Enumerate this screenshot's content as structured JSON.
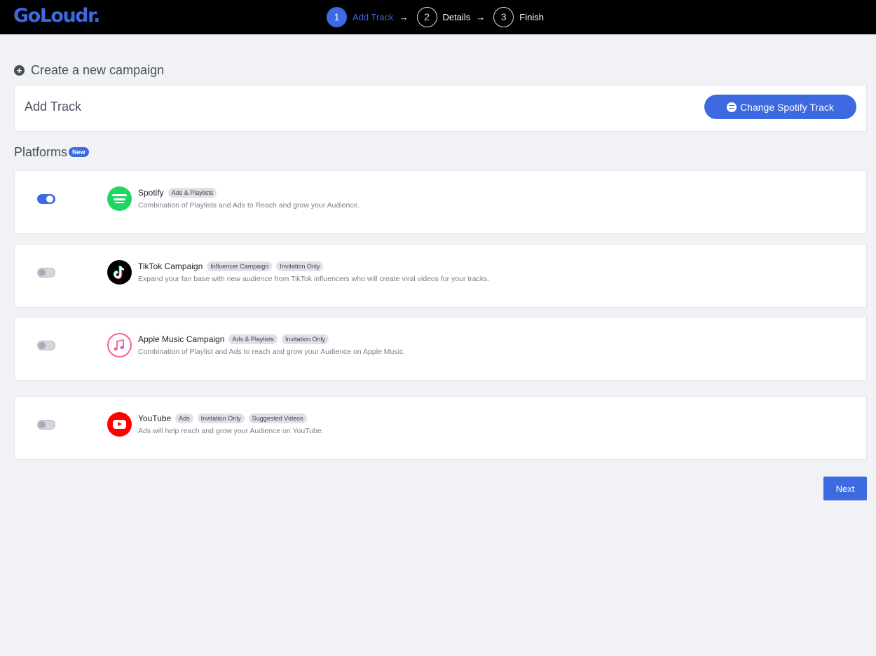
{
  "brand": {
    "logo": "GoLoudr."
  },
  "steps": [
    {
      "number": "1",
      "label": "Add Track",
      "active": true
    },
    {
      "number": "2",
      "label": "Details",
      "active": false
    },
    {
      "number": "3",
      "label": "Finish",
      "active": false
    }
  ],
  "page": {
    "title": "Create a new campaign"
  },
  "track": {
    "title": "Add Track",
    "change_button": "Change Spotify Track"
  },
  "platforms_section": {
    "title": "Platforms",
    "badge": "New"
  },
  "platforms": [
    {
      "name": "Spotify",
      "tags": [
        "Ads & Playlists"
      ],
      "description": "Combination of Playlists and Ads to Reach and grow your Audience.",
      "enabled": true,
      "icon": "spotify-icon"
    },
    {
      "name": "TikTok Campaign",
      "tags": [
        "Influencer Campaign",
        "Invitation Only"
      ],
      "description": "Expand your fan base with new audience from TikTok influencers who will create viral videos for your tracks.",
      "enabled": false,
      "icon": "tiktok-icon"
    },
    {
      "name": "Apple Music Campaign",
      "tags": [
        "Ads & Playlists",
        "Invitation Only"
      ],
      "description": "Combination of Playlist and Ads to reach and grow your Audience on Apple Music.",
      "enabled": false,
      "icon": "apple-music-icon"
    },
    {
      "name": "YouTube",
      "tags": [
        "Ads",
        "Invitation Only",
        "Suggested Videos"
      ],
      "description": "Ads will help reach and grow your Audience on YouTube.",
      "enabled": false,
      "icon": "youtube-icon"
    }
  ],
  "footer": {
    "next_label": "Next"
  },
  "colors": {
    "accent": "#3d6ae0",
    "topbar": "#000000",
    "background": "#f1f2f6"
  }
}
